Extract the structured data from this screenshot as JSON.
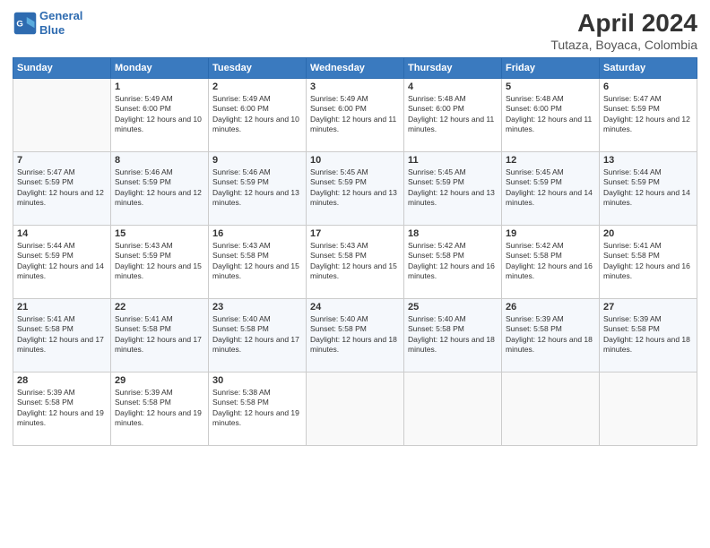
{
  "logo": {
    "line1": "General",
    "line2": "Blue"
  },
  "title": "April 2024",
  "location": "Tutaza, Boyaca, Colombia",
  "weekdays": [
    "Sunday",
    "Monday",
    "Tuesday",
    "Wednesday",
    "Thursday",
    "Friday",
    "Saturday"
  ],
  "weeks": [
    [
      {
        "day": "",
        "sunrise": "",
        "sunset": "",
        "daylight": ""
      },
      {
        "day": "1",
        "sunrise": "Sunrise: 5:49 AM",
        "sunset": "Sunset: 6:00 PM",
        "daylight": "Daylight: 12 hours and 10 minutes."
      },
      {
        "day": "2",
        "sunrise": "Sunrise: 5:49 AM",
        "sunset": "Sunset: 6:00 PM",
        "daylight": "Daylight: 12 hours and 10 minutes."
      },
      {
        "day": "3",
        "sunrise": "Sunrise: 5:49 AM",
        "sunset": "Sunset: 6:00 PM",
        "daylight": "Daylight: 12 hours and 11 minutes."
      },
      {
        "day": "4",
        "sunrise": "Sunrise: 5:48 AM",
        "sunset": "Sunset: 6:00 PM",
        "daylight": "Daylight: 12 hours and 11 minutes."
      },
      {
        "day": "5",
        "sunrise": "Sunrise: 5:48 AM",
        "sunset": "Sunset: 6:00 PM",
        "daylight": "Daylight: 12 hours and 11 minutes."
      },
      {
        "day": "6",
        "sunrise": "Sunrise: 5:47 AM",
        "sunset": "Sunset: 5:59 PM",
        "daylight": "Daylight: 12 hours and 12 minutes."
      }
    ],
    [
      {
        "day": "7",
        "sunrise": "Sunrise: 5:47 AM",
        "sunset": "Sunset: 5:59 PM",
        "daylight": "Daylight: 12 hours and 12 minutes."
      },
      {
        "day": "8",
        "sunrise": "Sunrise: 5:46 AM",
        "sunset": "Sunset: 5:59 PM",
        "daylight": "Daylight: 12 hours and 12 minutes."
      },
      {
        "day": "9",
        "sunrise": "Sunrise: 5:46 AM",
        "sunset": "Sunset: 5:59 PM",
        "daylight": "Daylight: 12 hours and 13 minutes."
      },
      {
        "day": "10",
        "sunrise": "Sunrise: 5:45 AM",
        "sunset": "Sunset: 5:59 PM",
        "daylight": "Daylight: 12 hours and 13 minutes."
      },
      {
        "day": "11",
        "sunrise": "Sunrise: 5:45 AM",
        "sunset": "Sunset: 5:59 PM",
        "daylight": "Daylight: 12 hours and 13 minutes."
      },
      {
        "day": "12",
        "sunrise": "Sunrise: 5:45 AM",
        "sunset": "Sunset: 5:59 PM",
        "daylight": "Daylight: 12 hours and 14 minutes."
      },
      {
        "day": "13",
        "sunrise": "Sunrise: 5:44 AM",
        "sunset": "Sunset: 5:59 PM",
        "daylight": "Daylight: 12 hours and 14 minutes."
      }
    ],
    [
      {
        "day": "14",
        "sunrise": "Sunrise: 5:44 AM",
        "sunset": "Sunset: 5:59 PM",
        "daylight": "Daylight: 12 hours and 14 minutes."
      },
      {
        "day": "15",
        "sunrise": "Sunrise: 5:43 AM",
        "sunset": "Sunset: 5:59 PM",
        "daylight": "Daylight: 12 hours and 15 minutes."
      },
      {
        "day": "16",
        "sunrise": "Sunrise: 5:43 AM",
        "sunset": "Sunset: 5:58 PM",
        "daylight": "Daylight: 12 hours and 15 minutes."
      },
      {
        "day": "17",
        "sunrise": "Sunrise: 5:43 AM",
        "sunset": "Sunset: 5:58 PM",
        "daylight": "Daylight: 12 hours and 15 minutes."
      },
      {
        "day": "18",
        "sunrise": "Sunrise: 5:42 AM",
        "sunset": "Sunset: 5:58 PM",
        "daylight": "Daylight: 12 hours and 16 minutes."
      },
      {
        "day": "19",
        "sunrise": "Sunrise: 5:42 AM",
        "sunset": "Sunset: 5:58 PM",
        "daylight": "Daylight: 12 hours and 16 minutes."
      },
      {
        "day": "20",
        "sunrise": "Sunrise: 5:41 AM",
        "sunset": "Sunset: 5:58 PM",
        "daylight": "Daylight: 12 hours and 16 minutes."
      }
    ],
    [
      {
        "day": "21",
        "sunrise": "Sunrise: 5:41 AM",
        "sunset": "Sunset: 5:58 PM",
        "daylight": "Daylight: 12 hours and 17 minutes."
      },
      {
        "day": "22",
        "sunrise": "Sunrise: 5:41 AM",
        "sunset": "Sunset: 5:58 PM",
        "daylight": "Daylight: 12 hours and 17 minutes."
      },
      {
        "day": "23",
        "sunrise": "Sunrise: 5:40 AM",
        "sunset": "Sunset: 5:58 PM",
        "daylight": "Daylight: 12 hours and 17 minutes."
      },
      {
        "day": "24",
        "sunrise": "Sunrise: 5:40 AM",
        "sunset": "Sunset: 5:58 PM",
        "daylight": "Daylight: 12 hours and 18 minutes."
      },
      {
        "day": "25",
        "sunrise": "Sunrise: 5:40 AM",
        "sunset": "Sunset: 5:58 PM",
        "daylight": "Daylight: 12 hours and 18 minutes."
      },
      {
        "day": "26",
        "sunrise": "Sunrise: 5:39 AM",
        "sunset": "Sunset: 5:58 PM",
        "daylight": "Daylight: 12 hours and 18 minutes."
      },
      {
        "day": "27",
        "sunrise": "Sunrise: 5:39 AM",
        "sunset": "Sunset: 5:58 PM",
        "daylight": "Daylight: 12 hours and 18 minutes."
      }
    ],
    [
      {
        "day": "28",
        "sunrise": "Sunrise: 5:39 AM",
        "sunset": "Sunset: 5:58 PM",
        "daylight": "Daylight: 12 hours and 19 minutes."
      },
      {
        "day": "29",
        "sunrise": "Sunrise: 5:39 AM",
        "sunset": "Sunset: 5:58 PM",
        "daylight": "Daylight: 12 hours and 19 minutes."
      },
      {
        "day": "30",
        "sunrise": "Sunrise: 5:38 AM",
        "sunset": "Sunset: 5:58 PM",
        "daylight": "Daylight: 12 hours and 19 minutes."
      },
      {
        "day": "",
        "sunrise": "",
        "sunset": "",
        "daylight": ""
      },
      {
        "day": "",
        "sunrise": "",
        "sunset": "",
        "daylight": ""
      },
      {
        "day": "",
        "sunrise": "",
        "sunset": "",
        "daylight": ""
      },
      {
        "day": "",
        "sunrise": "",
        "sunset": "",
        "daylight": ""
      }
    ]
  ]
}
